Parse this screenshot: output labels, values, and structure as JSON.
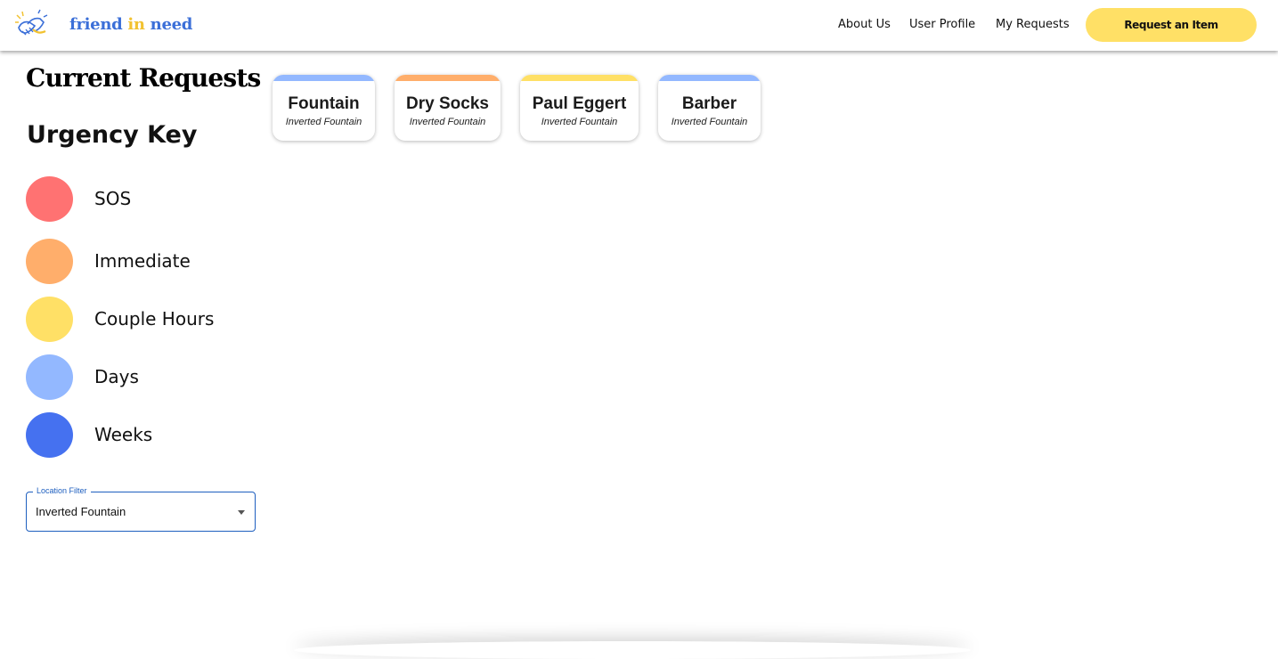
{
  "header": {
    "brand": {
      "w1": "friend",
      "w2": "in",
      "w3": "need"
    },
    "nav": {
      "about": "About Us",
      "profile": "User Profile",
      "requests": "My Requests"
    },
    "cta_label": "Request an Item",
    "cta_color": "#ffe066"
  },
  "sidebar": {
    "title": "Current Requests",
    "urgency_key_title": "Urgency Key",
    "urgency_levels": [
      {
        "label": "SOS",
        "color": "#ff7272"
      },
      {
        "label": "Immediate",
        "color": "#ffae6b"
      },
      {
        "label": "Couple Hours",
        "color": "#ffe066"
      },
      {
        "label": "Days",
        "color": "#93b8ff"
      },
      {
        "label": "Weeks",
        "color": "#4571f0"
      }
    ],
    "location_filter": {
      "legend": "Location Filter",
      "value": "Inverted Fountain"
    }
  },
  "requests": [
    {
      "title": "Fountain",
      "location": "Inverted Fountain",
      "urgency_color": "#93b8ff"
    },
    {
      "title": "Dry Socks",
      "location": "Inverted Fountain",
      "urgency_color": "#ffae6b"
    },
    {
      "title": "Paul Eggert",
      "location": "Inverted Fountain",
      "urgency_color": "#ffe066"
    },
    {
      "title": "Barber",
      "location": "Inverted Fountain",
      "urgency_color": "#93b8ff"
    }
  ]
}
